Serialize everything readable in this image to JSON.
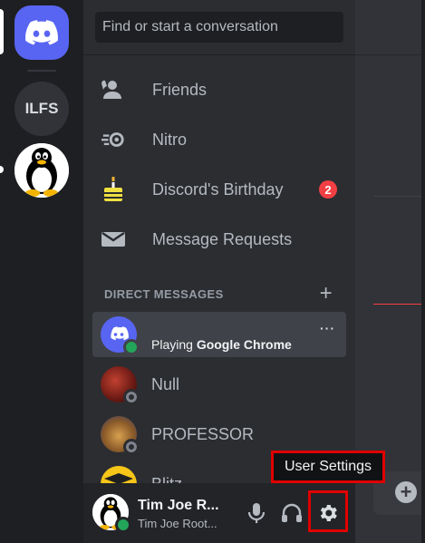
{
  "servers": {
    "home_icon": "discord-logo-icon",
    "ilfs_label": "ILFS",
    "tux_icon": "tux-penguin-icon"
  },
  "search": {
    "placeholder": "Find or start a conversation"
  },
  "nav": [
    {
      "label": "Friends",
      "icon": "friends-icon"
    },
    {
      "label": "Nitro",
      "icon": "nitro-icon"
    },
    {
      "label": "Discord's Birthday",
      "icon": "birthday-cake-icon",
      "badge": "2"
    },
    {
      "label": "Message Requests",
      "icon": "envelope-icon"
    }
  ],
  "direct_messages": {
    "header": "DIRECT MESSAGES",
    "add_icon": "plus-icon",
    "items": [
      {
        "name": "",
        "activity_prefix": "Playing ",
        "activity_app": "Google Chrome",
        "status": "online",
        "more": "···"
      },
      {
        "name": "Null",
        "status": "offline"
      },
      {
        "name": "PROFESSOR",
        "status": "offline"
      },
      {
        "name": "Blitz",
        "status": "offline"
      }
    ]
  },
  "user_panel": {
    "name": "Tim Joe R...",
    "subtext": "Tim Joe Root...",
    "status": "online",
    "buttons": [
      "microphone-icon",
      "headphones-icon",
      "gear-icon"
    ]
  },
  "tooltip": {
    "text": "User Settings"
  },
  "colors": {
    "blurple": "#5865f2",
    "online": "#23a55a",
    "badge_red": "#f23f43",
    "highlight_red": "#e00000"
  }
}
